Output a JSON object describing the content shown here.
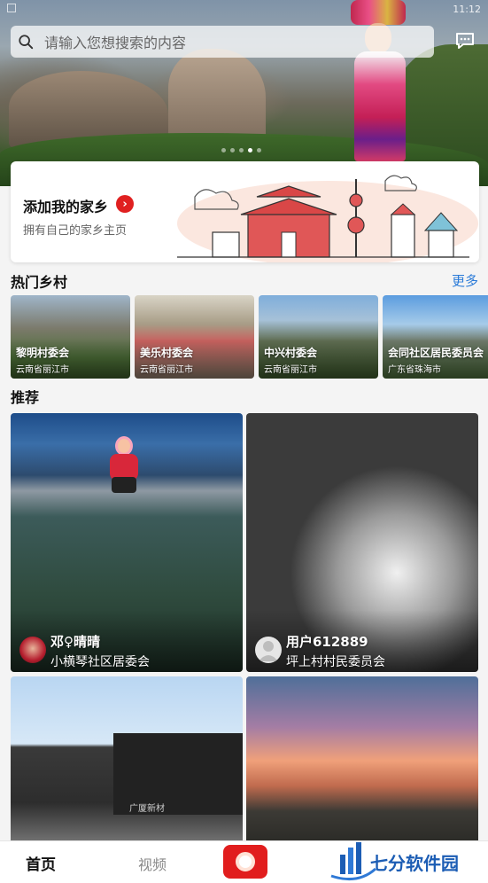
{
  "status_bar": {
    "time": "11:12"
  },
  "search": {
    "placeholder": "请输入您想搜索的内容"
  },
  "banner": {
    "slides": 5,
    "active_index": 3
  },
  "hometown_card": {
    "title": "添加我的家乡",
    "subtitle": "拥有自己的家乡主页"
  },
  "hot_villages": {
    "title": "热门乡村",
    "more": "更多",
    "items": [
      {
        "name": "黎明村委会",
        "location": "云南省丽江市"
      },
      {
        "name": "美乐村委会",
        "location": "云南省丽江市"
      },
      {
        "name": "中兴村委会",
        "location": "云南省丽江市"
      },
      {
        "name": "会同社区居民委员会",
        "location": "广东省珠海市"
      }
    ]
  },
  "recommend": {
    "title": "推荐",
    "posts": [
      {
        "user": "邓♀晴晴",
        "org": "小横琴社区居委会"
      },
      {
        "user": "用户612889",
        "org": "坪上村村民委员会"
      },
      {
        "sign_text": "广厦新材"
      },
      {}
    ]
  },
  "nav": {
    "home": "首页",
    "video": "视频"
  },
  "watermark": {
    "text": "七分软件园"
  },
  "colors": {
    "accent_red": "#e11d1d",
    "link_blue": "#2b7bd8"
  }
}
